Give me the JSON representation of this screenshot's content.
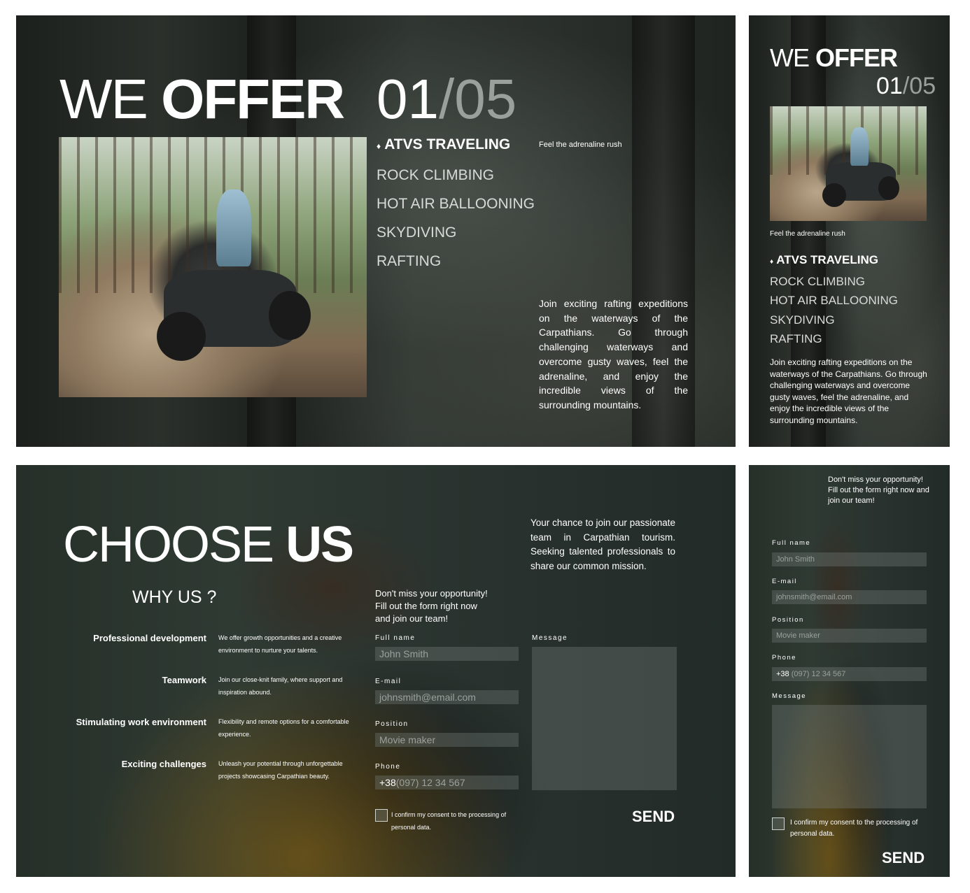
{
  "offer": {
    "title_light": "WE",
    "title_bold": "OFFER",
    "counter_current": "01",
    "counter_sep": "/",
    "counter_total": "05",
    "tagline": "Feel the adrenaline rush",
    "active_bullet": "♦",
    "menu": [
      "ATVS TRAVELING",
      "ROCK CLIMBING",
      "HOT AIR BALLOONING",
      "SKYDIVING",
      "RAFTING"
    ],
    "description": "Join exciting rafting expeditions on the waterways of the Carpathians. Go through challenging waterways and overcome gusty waves, feel the adrenaline, and enjoy the incredible views of the surrounding mountains."
  },
  "choose": {
    "title_light": "CHOOSE",
    "title_bold": "US",
    "why_heading": "WHY US ?",
    "intro": "Your chance to join our passionate team in Carpathian tourism. Seeking talented professionals to share our common mission.",
    "reasons": [
      {
        "title": "Professional development",
        "text": "We offer growth opportunities and a creative environment to nurture your talents."
      },
      {
        "title": "Teamwork",
        "text": "Join our close-knit family, where support and inspiration abound."
      },
      {
        "title": "Stimulating work environment",
        "text": "Flexibility and remote options for a comfortable experience."
      },
      {
        "title": "Exciting challenges",
        "text": "Unleash your potential through unforgettable projects showcasing Carpathian beauty."
      }
    ],
    "form_prompt": "Don't miss your opportunity! Fill out the form right now and join our team!",
    "form_prompt_desktop": [
      "Don't miss your opportunity!",
      "Fill out the form right now",
      "and join our team!"
    ],
    "fields": {
      "full_name": {
        "label": "Full name",
        "placeholder": "John Smith"
      },
      "email": {
        "label": "E-mail",
        "placeholder": "johnsmith@email.com"
      },
      "position": {
        "label": "Position",
        "placeholder": "Movie maker"
      },
      "phone": {
        "label": "Phone",
        "prefix": "+38",
        "placeholder": "(097) 12 34 567"
      },
      "message": {
        "label": "Message"
      }
    },
    "consent": "I confirm my consent to the processing of personal data.",
    "send": "SEND"
  }
}
